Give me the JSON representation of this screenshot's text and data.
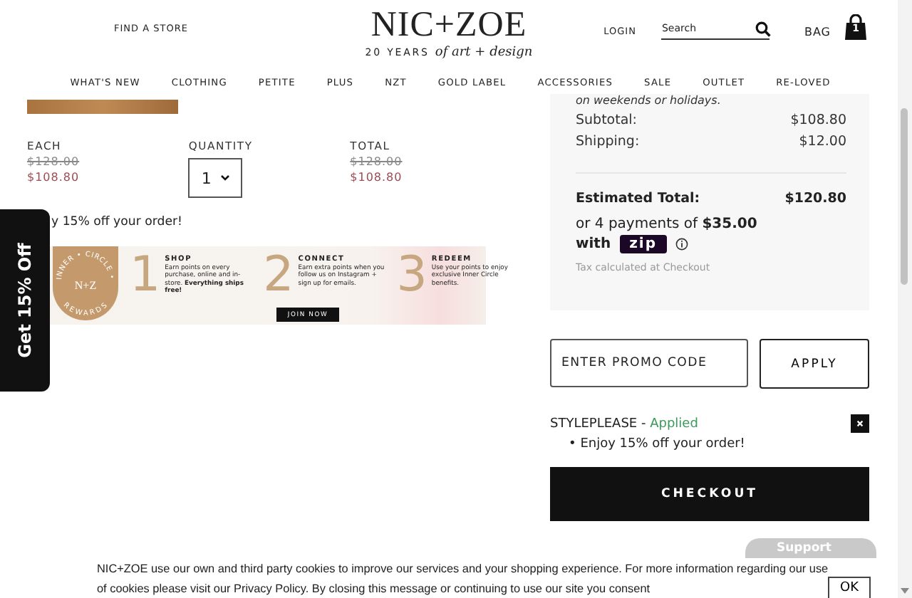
{
  "header": {
    "find_store": "FIND A STORE",
    "logo": {
      "name": "NIC+ZOE",
      "tagline": "20 YEARS",
      "tagline_script": "of art + design"
    },
    "login": "LOGIN",
    "search": {
      "placeholder": "Search"
    },
    "bag": {
      "label": "BAG",
      "count": "1"
    }
  },
  "nav": [
    "WHAT'S NEW",
    "CLOTHING",
    "PETITE",
    "PLUS",
    "NZT",
    "GOLD LABEL",
    "ACCESSORIES",
    "SALE",
    "OUTLET",
    "RE-LOVED"
  ],
  "cart_item": {
    "each": {
      "label": "EACH",
      "original_price": "$128.00",
      "price": "$108.80"
    },
    "quantity": {
      "label": "QUANTITY",
      "value": "1"
    },
    "total": {
      "label": "TOTAL",
      "original_price": "$128.00",
      "price": "$108.80"
    },
    "promo_note": "y 15% off your order!"
  },
  "rewards_banner": {
    "badge": {
      "ring_top": "INNER • CIRCLE •",
      "ring_bottom": "REWARDS",
      "monogram": "N+Z"
    },
    "steps": [
      {
        "number": "1",
        "title": "SHOP",
        "text": "Earn points on every purchase, online and in-store. **Everything ships free!**"
      },
      {
        "number": "2",
        "title": "CONNECT",
        "text": "Earn extra points when you follow us on Instagram + sign up for emails."
      },
      {
        "number": "3",
        "title": "REDEEM",
        "text": "Use your points to enjoy exclusive Inner Circle benefits."
      }
    ],
    "button": "JOIN NOW"
  },
  "side_tab": "Get 15% Off",
  "summary": {
    "note": "on weekends or holidays.",
    "lines": [
      {
        "label": "Subtotal:",
        "value": "$108.80"
      },
      {
        "label": "Shipping:",
        "value": "$12.00"
      }
    ],
    "total": {
      "label": "Estimated Total:",
      "value": "$120.80"
    },
    "installments": "or 4 payments of **$35.00**",
    "with": "with",
    "zip": "zip",
    "tax": "Tax calculated at Checkout"
  },
  "promo": {
    "placeholder": "ENTER PROMO CODE",
    "apply": "APPLY",
    "applied_code": "STYLEPLEASE",
    "separator": "-",
    "status": "Applied",
    "bullet": "•",
    "benefit": "Enjoy 15% off your order!"
  },
  "checkout": "CHECKOUT",
  "support": "Support",
  "cookie": {
    "text": "NIC+ZOE use our own and third party cookies to improve our services and your shopping experience. For more information regarding our use of cookies please visit our Privacy Policy. By closing this message or continuing to use our site you consent",
    "ok": "OK"
  }
}
